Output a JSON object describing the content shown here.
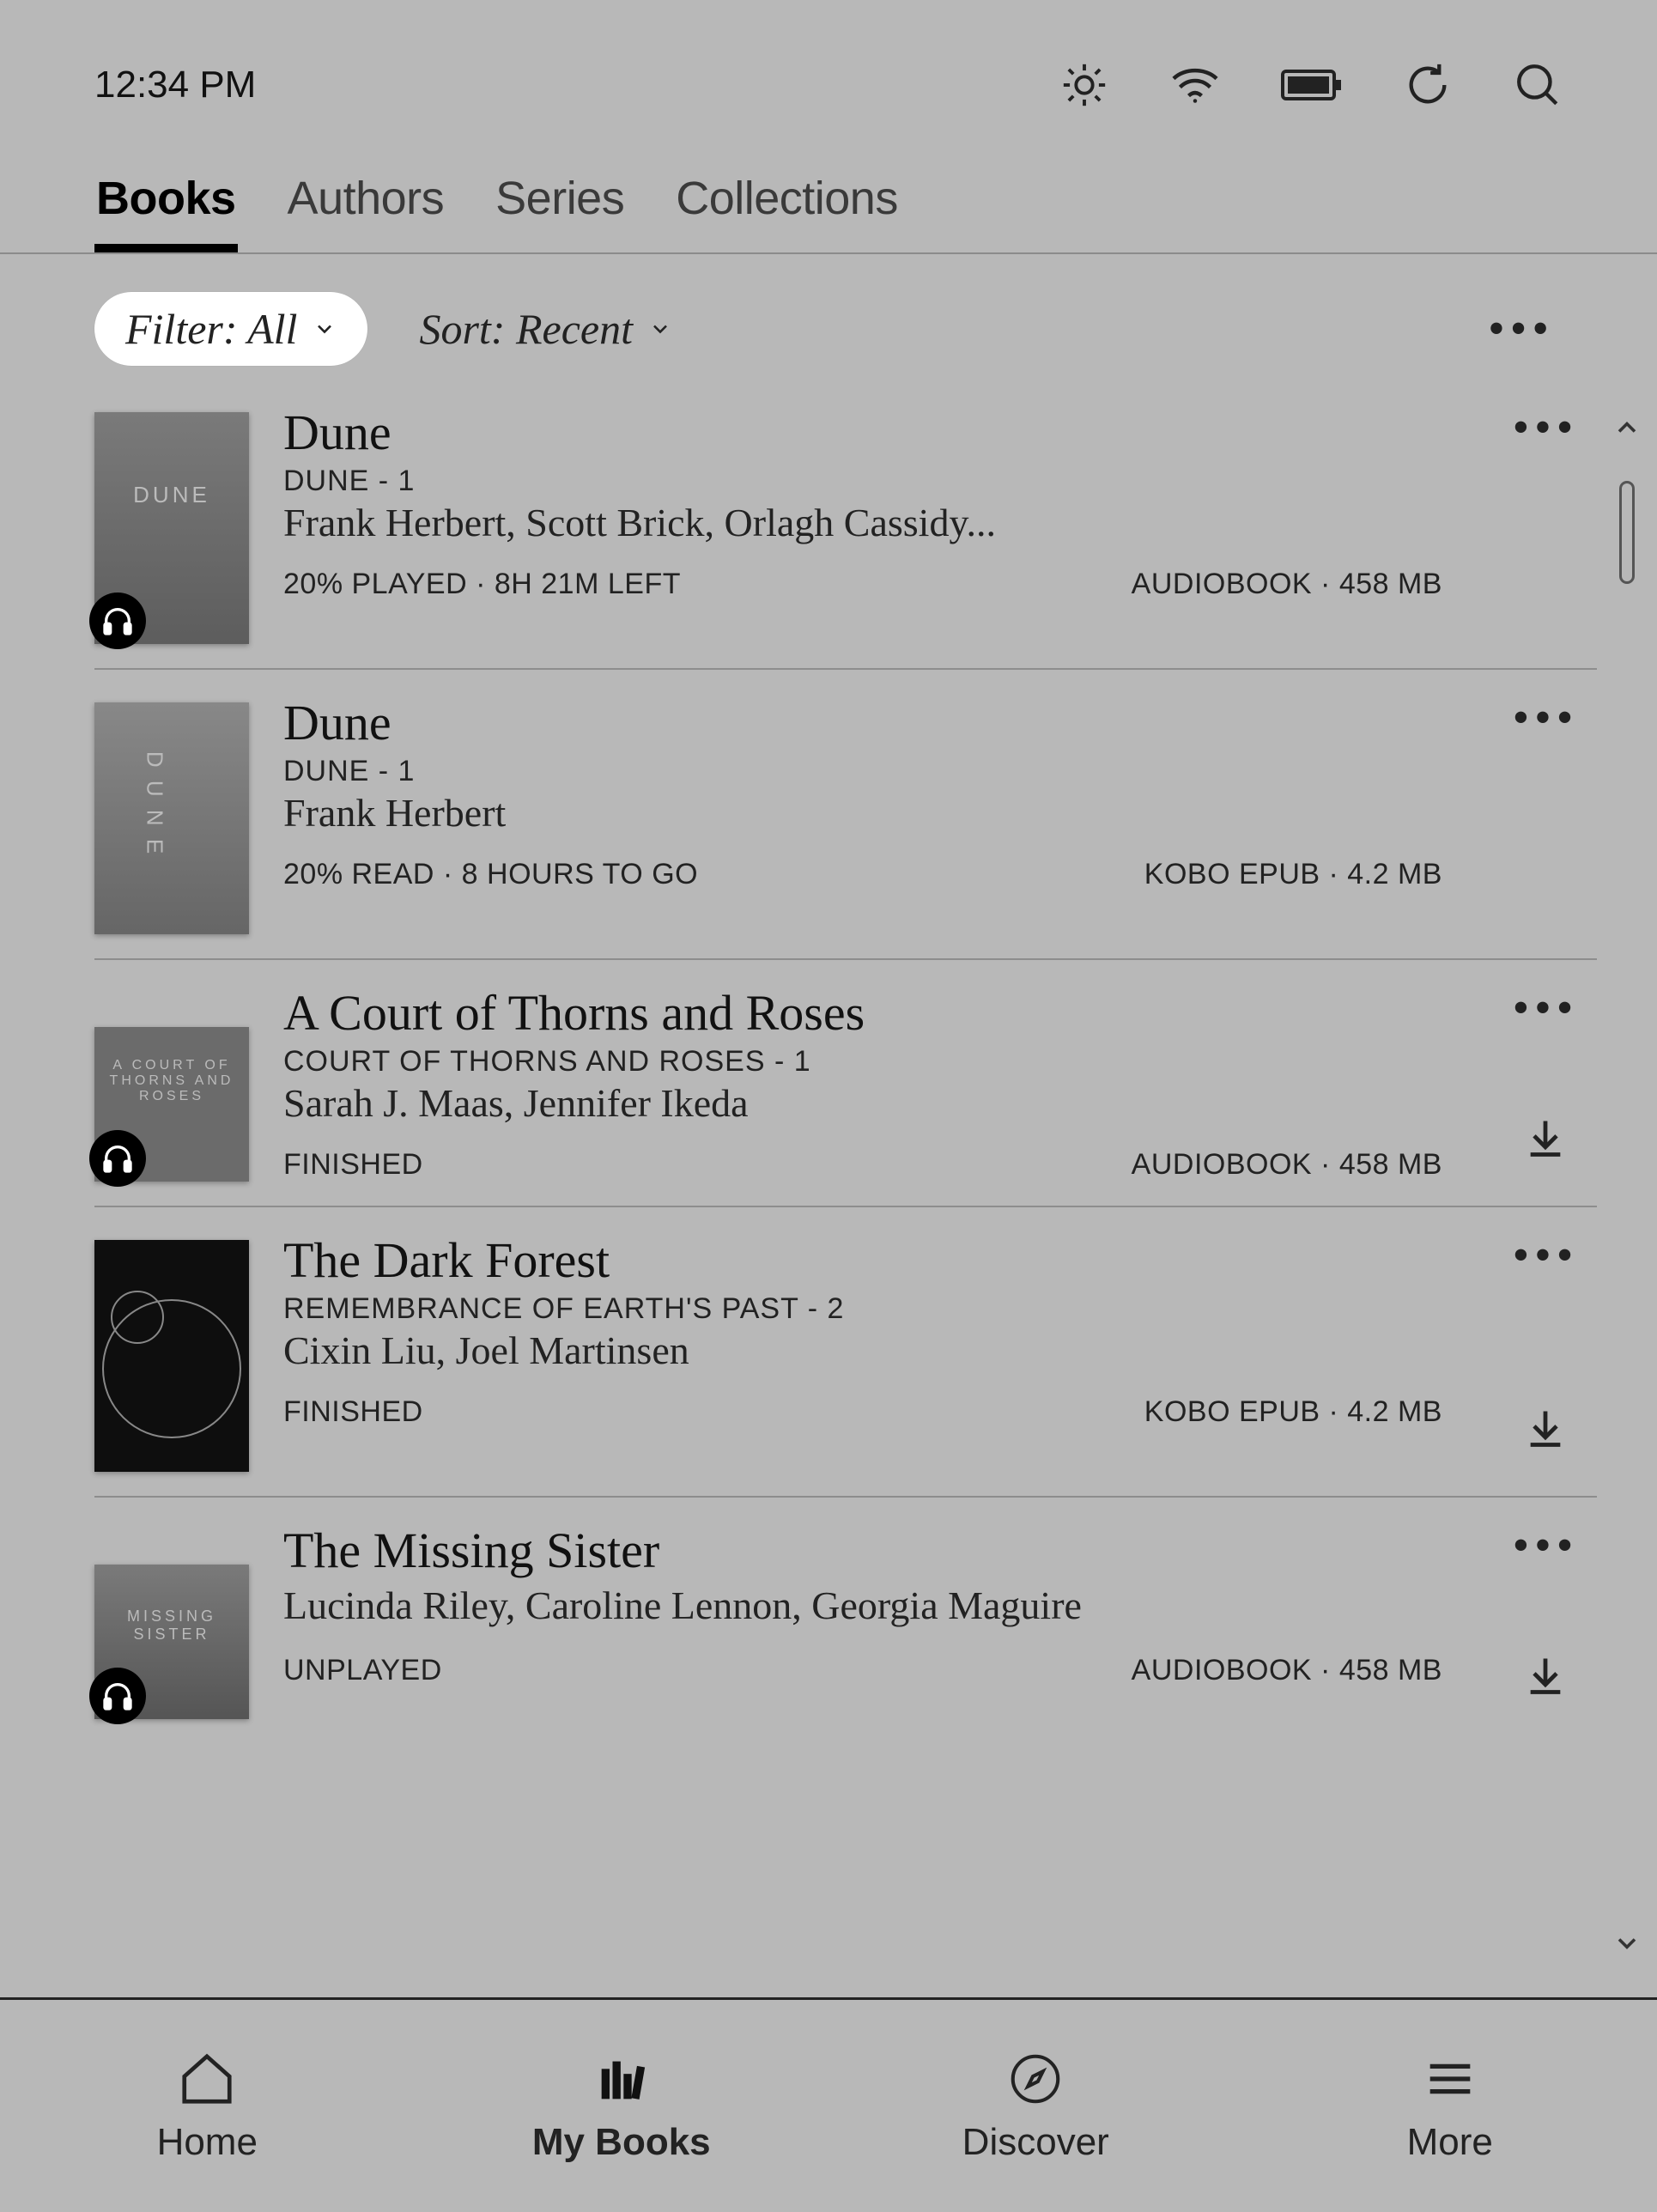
{
  "status": {
    "time": "12:34 PM"
  },
  "tabs": {
    "t0": "Books",
    "t1": "Authors",
    "t2": "Series",
    "t3": "Collections"
  },
  "filter": {
    "label": "Filter: All"
  },
  "sort": {
    "label": "Sort: Recent"
  },
  "books": [
    {
      "title": "Dune",
      "series": "DUNE - 1",
      "authors": "Frank Herbert, Scott Brick, Orlagh Cassidy...",
      "progress": "20% PLAYED · 8H 21M LEFT",
      "format": "AUDIOBOOK · 458 MB",
      "audiobook": true,
      "downloadable": false
    },
    {
      "title": "Dune",
      "series": "DUNE - 1",
      "authors": "Frank Herbert",
      "progress": "20% READ · 8 HOURS TO GO",
      "format": "KOBO EPUB · 4.2 MB",
      "audiobook": false,
      "downloadable": false
    },
    {
      "title": "A Court of Thorns and Roses",
      "series": "COURT OF THORNS AND ROSES - 1",
      "authors": "Sarah J. Maas, Jennifer Ikeda",
      "progress": "FINISHED",
      "format": "AUDIOBOOK · 458 MB",
      "audiobook": true,
      "downloadable": true
    },
    {
      "title": "The Dark Forest",
      "series": "REMEMBRANCE OF EARTH'S PAST - 2",
      "authors": "Cixin Liu, Joel Martinsen",
      "progress": "FINISHED",
      "format": "KOBO EPUB · 4.2 MB",
      "audiobook": false,
      "downloadable": true
    },
    {
      "title": "The Missing Sister",
      "series": "",
      "authors": "Lucinda Riley, Caroline Lennon, Georgia Maguire",
      "progress": "UNPLAYED",
      "format": "AUDIOBOOK · 458 MB",
      "audiobook": true,
      "downloadable": true
    }
  ],
  "nav": {
    "n0": "Home",
    "n1": "My Books",
    "n2": "Discover",
    "n3": "More"
  }
}
